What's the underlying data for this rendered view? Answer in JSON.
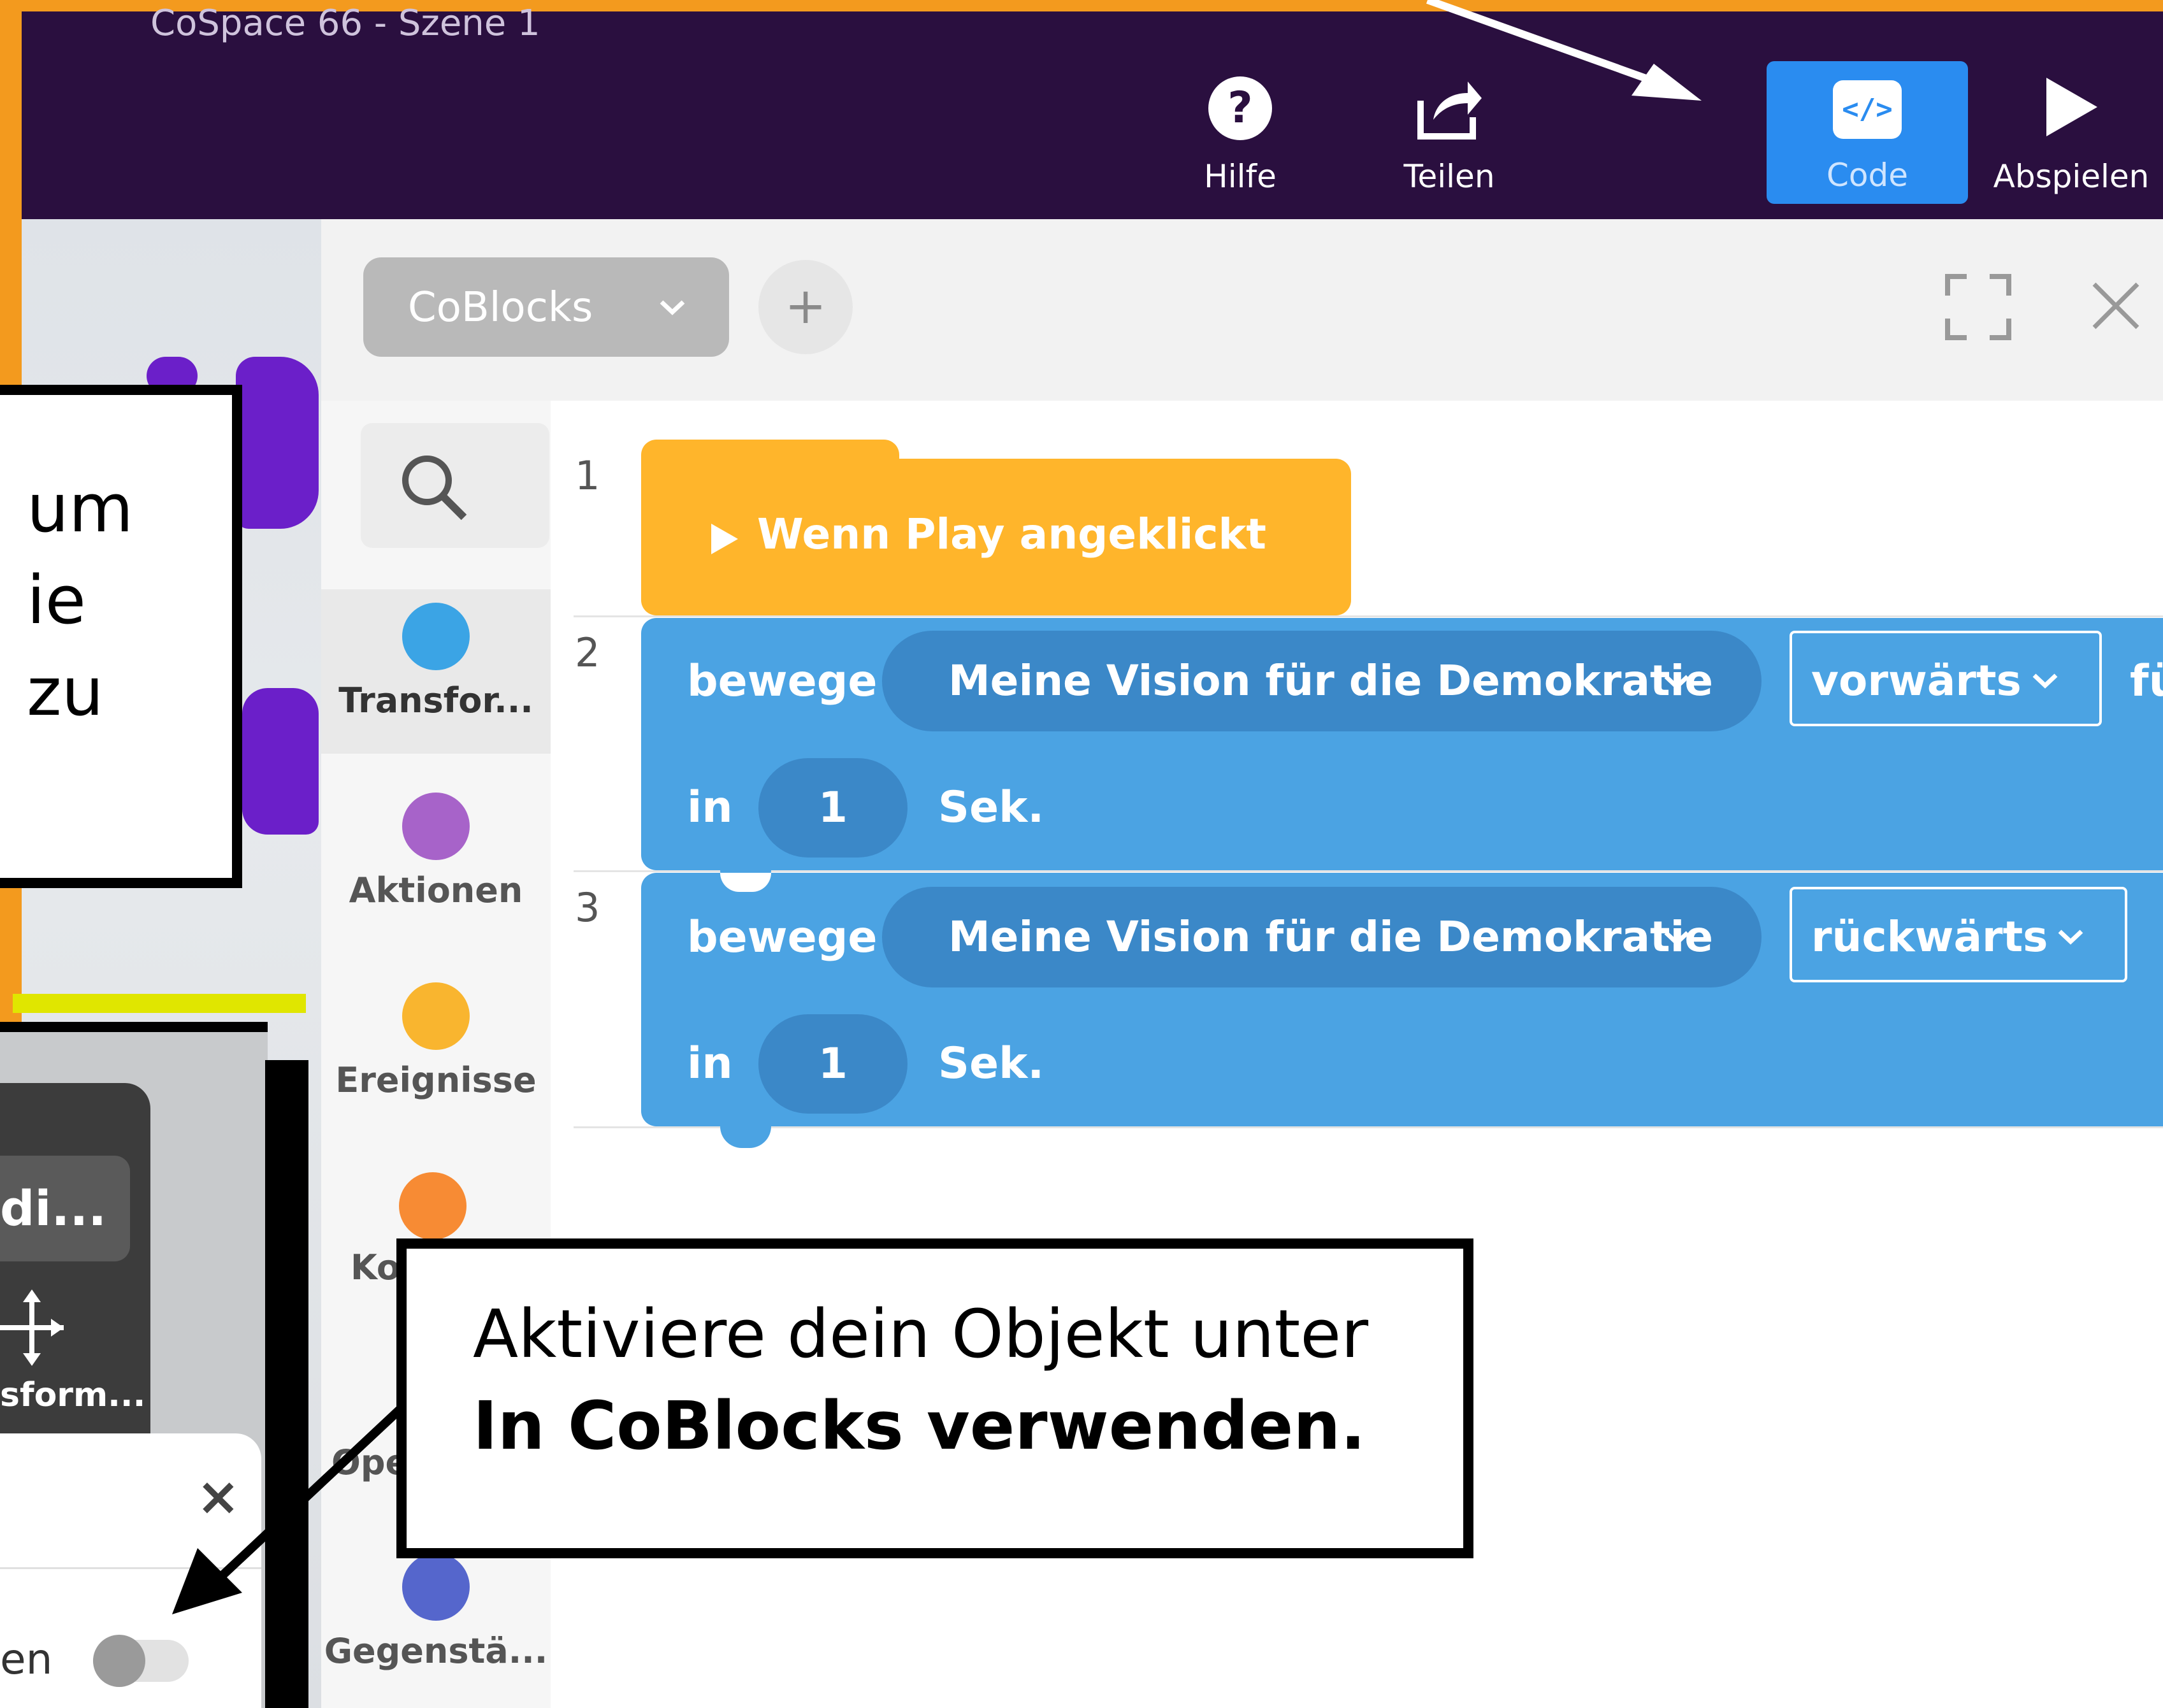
{
  "window": {
    "scene_title": "CoSpace 66 - Szene 1"
  },
  "toolbar": {
    "help_label": "Hilfe",
    "share_label": "Teilen",
    "code_label": "Code",
    "play_label": "Abspielen"
  },
  "editor": {
    "mode_dropdown": "CoBlocks",
    "add_label": "+",
    "categories": [
      {
        "label": "Transfor...",
        "color": "#3ba4e5"
      },
      {
        "label": "Aktionen",
        "color": "#a763c9"
      },
      {
        "label": "Ereignisse",
        "color": "#f9b52f"
      },
      {
        "label": "Ko",
        "color": "#f78b34"
      },
      {
        "label": "Ope",
        "color": "#5cb85c"
      },
      {
        "label": "Gegenstä...",
        "color": "#5566cc"
      }
    ],
    "line_numbers": [
      "1",
      "2",
      "3"
    ],
    "blocks": {
      "hat": "Wenn Play angeklickt",
      "move1": {
        "verb": "bewege",
        "object": "Meine Vision für die Demokratie",
        "direction": "vorwärts",
        "cut": "fü",
        "in_label": "in",
        "seconds": "1",
        "unit": "Sek."
      },
      "move2": {
        "verb": "bewege",
        "object": "Meine Vision für die Demokratie",
        "direction": "rückwärts",
        "in_label": "in",
        "seconds": "1",
        "unit": "Sek."
      }
    }
  },
  "left_callout": {
    "line1": "um",
    "line2": "ie",
    "line3": "zu"
  },
  "main_callout": {
    "line1": "Aktiviere dein Objekt unter",
    "line2": "In CoBlocks verwenden."
  },
  "side_panel": {
    "edit_label": "di...",
    "transform_label": "sform...",
    "toggle_label": "en",
    "close_label": "×"
  },
  "colors": {
    "accent": "#2a8cf0",
    "topbar": "#2a0f3f",
    "hat_block": "#ffb52b",
    "move_block": "#4ba3e3",
    "frame": "#f39a1e"
  }
}
